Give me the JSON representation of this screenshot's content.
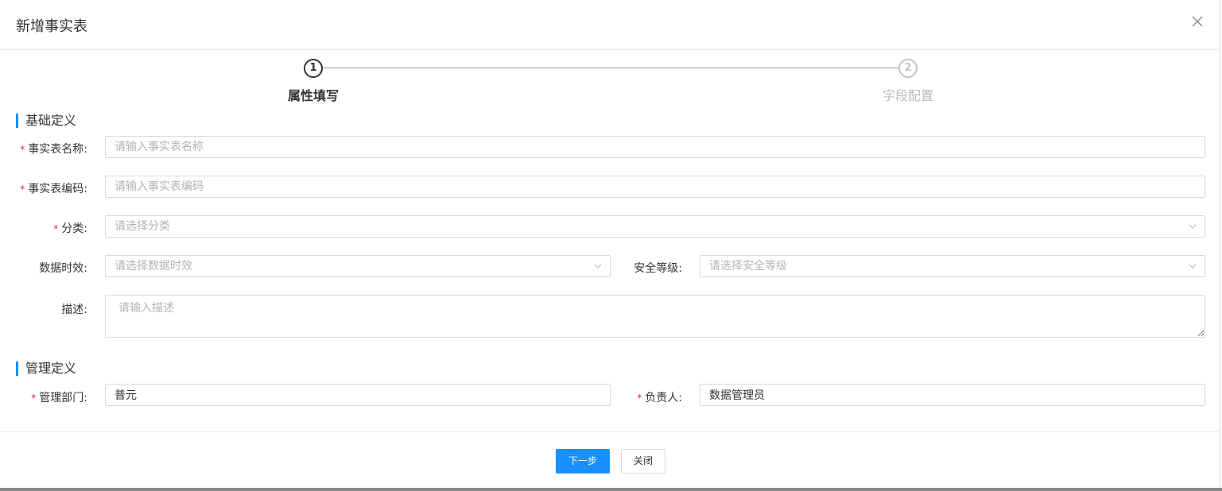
{
  "modal": {
    "title": "新增事实表"
  },
  "steps": [
    {
      "number": "1",
      "label": "属性填写"
    },
    {
      "number": "2",
      "label": "字段配置"
    }
  ],
  "sections": {
    "basic": "基础定义",
    "management": "管理定义"
  },
  "form": {
    "fact_name": {
      "label": "事实表名称:",
      "placeholder": "请输入事实表名称"
    },
    "fact_code": {
      "label": "事实表编码:",
      "placeholder": "请输入事实表编码"
    },
    "category": {
      "label": "分类:",
      "placeholder": "请选择分类"
    },
    "timeliness": {
      "label": "数据时效:",
      "placeholder": "请选择数据时效"
    },
    "security_level": {
      "label": "安全等级:",
      "placeholder": "请选择安全等级"
    },
    "description": {
      "label": "描述:",
      "placeholder": "请输入描述"
    },
    "department": {
      "label": "管理部门:",
      "value": "普元"
    },
    "owner": {
      "label": "负责人:",
      "value": "数据管理员"
    }
  },
  "required_mark": "*",
  "footer": {
    "next_label": "下一步",
    "close_label": "关闭"
  },
  "colors": {
    "primary": "#1890ff",
    "required": "#f5222d"
  }
}
